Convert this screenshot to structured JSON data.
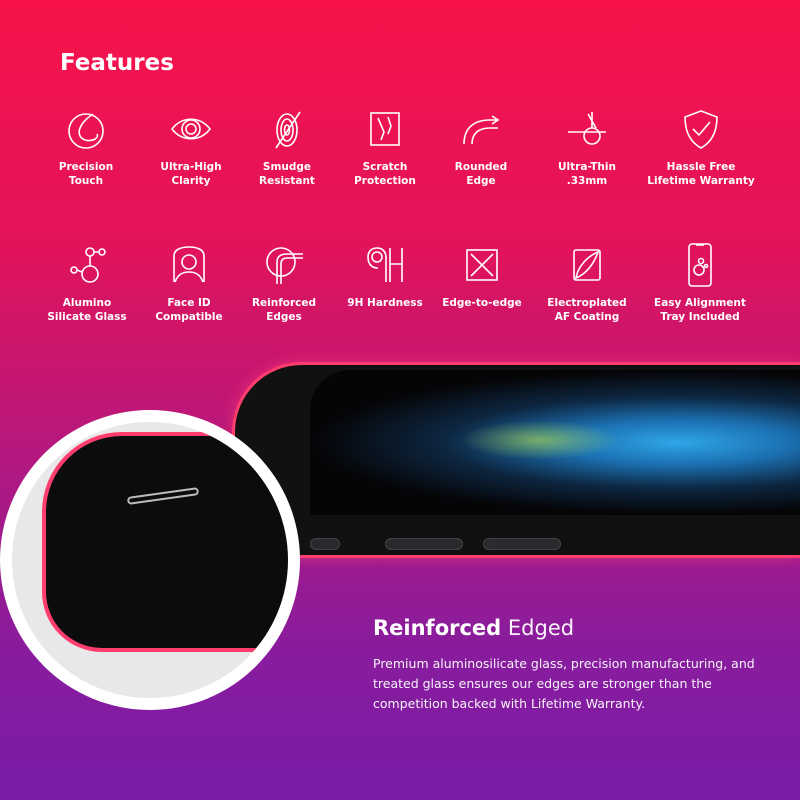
{
  "title": "Features",
  "features_row1": [
    {
      "icon": "touch-icon",
      "label": "Precision\nTouch"
    },
    {
      "icon": "eye-icon",
      "label": "Ultra-High\nClarity"
    },
    {
      "icon": "fingerprint-slash-icon",
      "label": "Smudge\nResistant"
    },
    {
      "icon": "scratch-icon",
      "label": "Scratch\nProtection"
    },
    {
      "icon": "rounded-edge-icon",
      "label": "Rounded\nEdge"
    },
    {
      "icon": "thin-layer-icon",
      "label": "Ultra-Thin\n.33mm"
    },
    {
      "icon": "shield-check-icon",
      "label": "Hassle Free\nLifetime Warranty"
    }
  ],
  "features_row2": [
    {
      "icon": "molecule-icon",
      "label": "Alumino\nSilicate Glass"
    },
    {
      "icon": "face-id-icon",
      "label": "Face ID\nCompatible"
    },
    {
      "icon": "reinforced-edge-icon",
      "label": "Reinforced\nEdges"
    },
    {
      "icon": "9h-icon",
      "label": "9H Hardness"
    },
    {
      "icon": "edge-to-edge-icon",
      "label": "Edge-to-edge"
    },
    {
      "icon": "coating-icon",
      "label": "Electroplated\nAF Coating"
    },
    {
      "icon": "phone-tray-icon",
      "label": "Easy Alignment\nTray Included"
    }
  ],
  "section": {
    "title_bold": "Reinforced",
    "title_light": "Edged",
    "description": "Premium aluminosilicate glass, precision manufacturing, and treated glass ensures our edges are stronger than the competition backed with Lifetime Warranty."
  },
  "colors": {
    "top": "#f7134a",
    "bottom": "#7a1ca8",
    "edge_glow": "#ff3d6e"
  }
}
